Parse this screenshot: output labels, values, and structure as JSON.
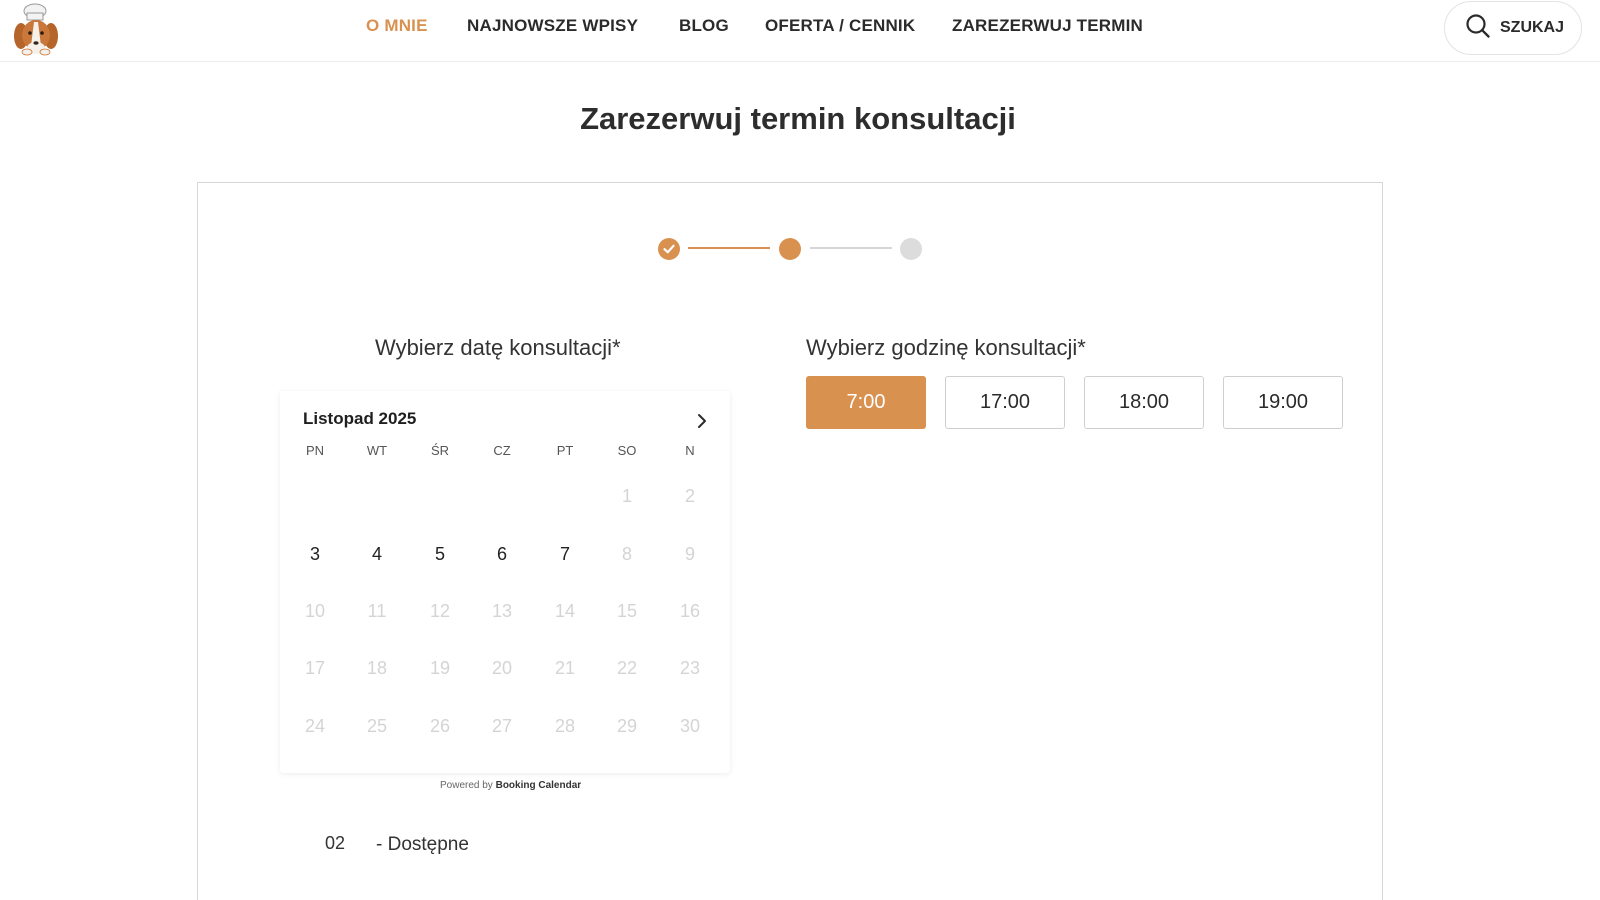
{
  "nav": {
    "items": [
      {
        "label": "O MNIE",
        "active": true
      },
      {
        "label": "NAJNOWSZE WPISY",
        "active": false
      },
      {
        "label": "BLOG",
        "active": false
      },
      {
        "label": "OFERTA / CENNIK",
        "active": false
      },
      {
        "label": "ZAREZERWUJ TERMIN",
        "active": false
      }
    ],
    "search_label": "SZUKAJ",
    "search_icon": "search-icon",
    "logo_icon": "dog-chef-logo"
  },
  "page": {
    "title": "Zarezerwuj termin konsultacji"
  },
  "stepper": {
    "steps": [
      {
        "state": "completed"
      },
      {
        "state": "current"
      },
      {
        "state": "upcoming"
      }
    ]
  },
  "booking": {
    "date_title": "Wybierz datę konsultacji*",
    "time_title": "Wybierz godzinę konsultacji*",
    "calendar": {
      "month": "Listopad 2025",
      "weekdays": [
        "PN",
        "WT",
        "ŚR",
        "CZ",
        "PT",
        "SO",
        "N"
      ],
      "weeks": [
        [
          null,
          null,
          null,
          null,
          null,
          "1",
          "2"
        ],
        [
          "3",
          "4",
          "5",
          "6",
          "7",
          "8",
          "9"
        ],
        [
          "10",
          "11",
          "12",
          "13",
          "14",
          "15",
          "16"
        ],
        [
          "17",
          "18",
          "19",
          "20",
          "21",
          "22",
          "23"
        ],
        [
          "24",
          "25",
          "26",
          "27",
          "28",
          "29",
          "30"
        ]
      ],
      "available_days": [
        "3",
        "4",
        "5",
        "6",
        "7"
      ],
      "powered_prefix": "Powered by",
      "powered_brand": "Booking Calendar"
    },
    "legend": {
      "number": "02",
      "text": "- Dostępne"
    },
    "time_slots": [
      {
        "label": "7:00",
        "selected": true
      },
      {
        "label": "17:00",
        "selected": false
      },
      {
        "label": "18:00",
        "selected": false
      },
      {
        "label": "19:00",
        "selected": false
      }
    ]
  },
  "colors": {
    "accent": "#d9914f",
    "text": "#2b2b2b",
    "muted": "#d4d4d4"
  }
}
